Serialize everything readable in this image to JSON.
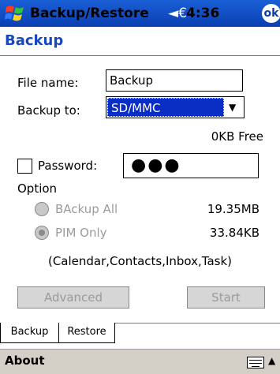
{
  "titlebar": {
    "title": "Backup/Restore",
    "speaker_icon": "◄€",
    "time": "4:36",
    "ok_label": "ok"
  },
  "page": {
    "title": "Backup"
  },
  "form": {
    "filename_label": "File name:",
    "filename_value": "Backup",
    "backupto_label": "Backup to:",
    "backupto_value": "SD/MMC",
    "free_space": "0KB Free",
    "password_label": "Password:",
    "password_dots": "●●●",
    "option_label": "Option",
    "backup_all_label": "BAckup All",
    "backup_all_size": "19.35MB",
    "pim_only_label": "PIM Only",
    "pim_only_size": "33.84KB",
    "pim_note": "(Calendar,Contacts,Inbox,Task)",
    "advanced_label": "Advanced",
    "start_label": "Start"
  },
  "tabs": [
    {
      "label": "Backup"
    },
    {
      "label": "Restore"
    }
  ],
  "menubar": {
    "about_label": "About",
    "sip_arrow": "▲"
  },
  "colors": {
    "titlebar": "#0a3fb2",
    "accent": "#1746c0",
    "selection": "#0a2ec4"
  }
}
